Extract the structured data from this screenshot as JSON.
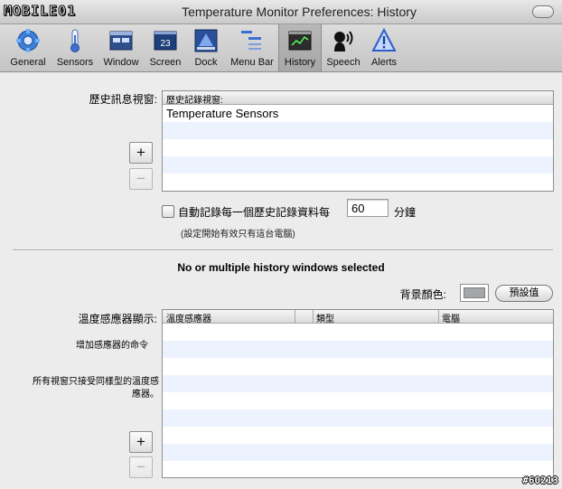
{
  "watermark": "MOBILE01",
  "window": {
    "title": "Temperature Monitor Preferences: History"
  },
  "toolbar": {
    "items": [
      {
        "label": "General",
        "icon": "gear-icon"
      },
      {
        "label": "Sensors",
        "icon": "thermometer-icon"
      },
      {
        "label": "Window",
        "icon": "window-icon"
      },
      {
        "label": "Screen",
        "icon": "screen-icon"
      },
      {
        "label": "Dock",
        "icon": "dock-icon"
      },
      {
        "label": "Menu Bar",
        "icon": "menu-bar-icon"
      },
      {
        "label": "History",
        "icon": "history-icon"
      },
      {
        "label": "Speech",
        "icon": "speech-icon"
      },
      {
        "label": "Alerts",
        "icon": "alert-icon"
      }
    ],
    "selected": "History"
  },
  "history": {
    "section_label": "歷史訊息視窗:",
    "column_header": "歷史記錄視窗:",
    "rows": [
      "Temperature Sensors"
    ],
    "add_label": "+",
    "remove_label": "−",
    "autosave_label": "自動記錄每一個歷史記錄資料每",
    "autosave_value": "60",
    "autosave_unit": "分鐘",
    "note": "(設定開始有效只有這台電腦)"
  },
  "selection_message": "No or multiple history windows selected",
  "background": {
    "label": "背景顏色:",
    "color": "#a4a6a8",
    "default_button": "預設值"
  },
  "sensors": {
    "section_label": "溫度感應器顯示:",
    "columns": [
      "溫度感應器",
      "類型",
      "電腦"
    ],
    "hint1": "增加感應器的命令",
    "hint2_line1": "所有視窗只接受同樣型的溫度感",
    "hint2_line2": "應器。",
    "add_label": "+",
    "remove_label": "−"
  },
  "corner_tag": "#60213"
}
